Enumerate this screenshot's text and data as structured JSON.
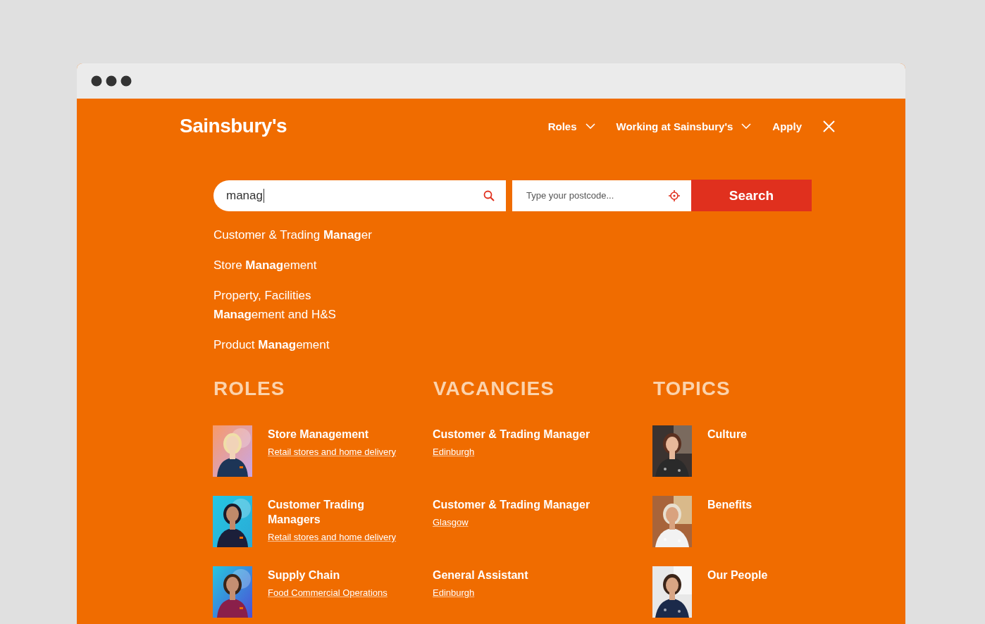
{
  "header": {
    "logo": "Sainsbury's",
    "nav": [
      {
        "label": "Roles",
        "kind": "dropdown"
      },
      {
        "label": "Working at Sainsbury's",
        "kind": "dropdown"
      },
      {
        "label": "Apply",
        "kind": "link"
      }
    ]
  },
  "search": {
    "query": "manag",
    "postcode_placeholder": "Type your postcode...",
    "button": "Search"
  },
  "suggestions": [
    "Customer & Trading **Manag**er",
    "Store **Manag**ement",
    "Property, Facilities **Manag**ement and H&S",
    "Product **Manag**ement"
  ],
  "roles": {
    "heading": "ROLES",
    "items": [
      {
        "title": "Store Management",
        "subtitle": "Retail stores and home delivery"
      },
      {
        "title": "Customer Trading Managers",
        "subtitle": "Retail stores and home delivery"
      },
      {
        "title": "Supply Chain",
        "subtitle": "Food Commercial Operations"
      }
    ]
  },
  "vacancies": {
    "heading": "VACANCIES",
    "items": [
      {
        "title": "Customer & Trading Manager",
        "location": "Edinburgh"
      },
      {
        "title": "Customer & Trading Manager",
        "location": "Glasgow"
      },
      {
        "title": "General Assistant",
        "location": "Edinburgh"
      }
    ]
  },
  "topics": {
    "heading": "TOPICS",
    "items": [
      {
        "title": "Culture"
      },
      {
        "title": "Benefits"
      },
      {
        "title": "Our People"
      }
    ]
  }
}
